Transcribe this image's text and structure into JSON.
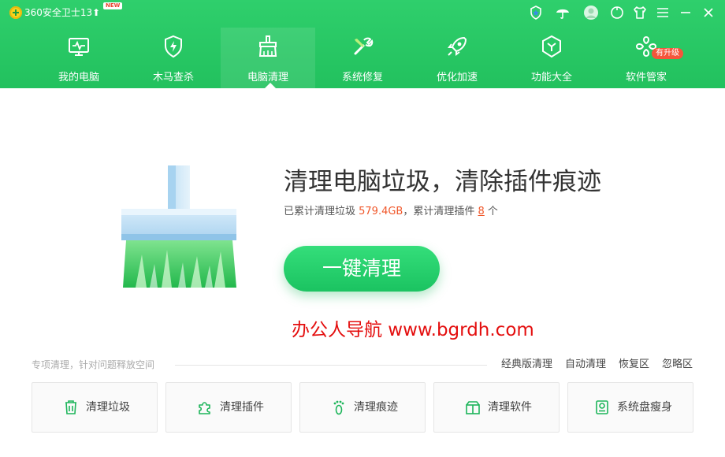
{
  "app": {
    "title": "360安全卫士13",
    "new_badge": "NEW",
    "upgrade_arrow": "⬆",
    "accent_color": "#22c15e",
    "title_bar_icons": [
      "shield-star-icon",
      "umbrella-icon",
      "user-avatar-icon",
      "skin-icon",
      "shirt-icon",
      "menu-icon",
      "minimize-icon",
      "close-icon"
    ]
  },
  "nav": {
    "items": [
      {
        "label": "我的电脑",
        "icon": "monitor-icon"
      },
      {
        "label": "木马查杀",
        "icon": "shield-bolt-icon"
      },
      {
        "label": "电脑清理",
        "icon": "broom-icon",
        "active": true
      },
      {
        "label": "系统修复",
        "icon": "wrench-icon"
      },
      {
        "label": "优化加速",
        "icon": "rocket-icon"
      },
      {
        "label": "功能大全",
        "icon": "cube-icon"
      },
      {
        "label": "软件管家",
        "icon": "apps-icon",
        "badge": "有升级"
      }
    ]
  },
  "hero": {
    "headline": "清理电脑垃圾，清除插件痕迹",
    "stats_prefix": "已累计清理垃圾 ",
    "stats_size": "579.4GB",
    "stats_middle": "，累计清理插件 ",
    "stats_count": "8",
    "stats_suffix": " 个",
    "button_label": "一键清理"
  },
  "watermark": "办公人导航 www.bgrdh.com",
  "special": {
    "label": "专项清理，针对问题释放空间",
    "links": [
      "经典版清理",
      "自动清理",
      "恢复区",
      "忽略区"
    ],
    "cards": [
      {
        "label": "清理垃圾",
        "icon": "trash-icon"
      },
      {
        "label": "清理插件",
        "icon": "puzzle-icon"
      },
      {
        "label": "清理痕迹",
        "icon": "footprint-icon"
      },
      {
        "label": "清理软件",
        "icon": "package-icon"
      },
      {
        "label": "系统盘瘦身",
        "icon": "disk-icon"
      }
    ]
  }
}
